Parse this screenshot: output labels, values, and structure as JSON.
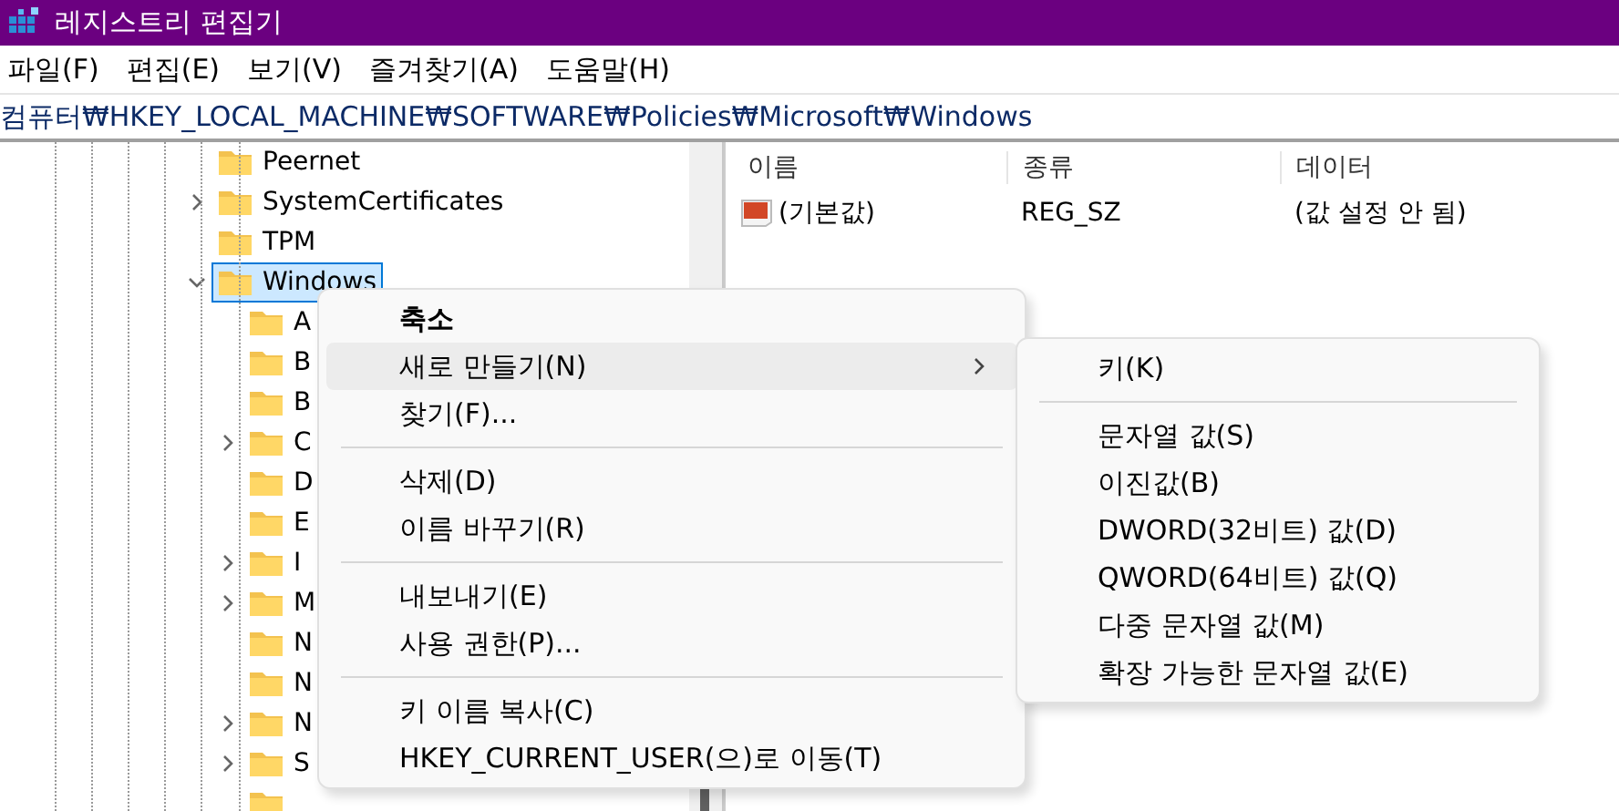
{
  "window": {
    "title": "레지스트리 편집기"
  },
  "menu_bar": [
    "파일(F)",
    "편집(E)",
    "보기(V)",
    "즐겨찾기(A)",
    "도움말(H)"
  ],
  "address_bar": {
    "value": "컴퓨터₩HKEY_LOCAL_MACHINE₩SOFTWARE₩Policies₩Microsoft₩Windows"
  },
  "tree": [
    {
      "label": "Peernet",
      "has_children": false,
      "expanded": false,
      "selected": false
    },
    {
      "label": "SystemCertificates",
      "has_children": true,
      "expanded": false,
      "selected": false
    },
    {
      "label": "TPM",
      "has_children": false,
      "expanded": false,
      "selected": false
    },
    {
      "label": "Windows",
      "has_children": true,
      "expanded": true,
      "selected": true,
      "children": [
        {
          "label": "A",
          "has_children": false,
          "expanded": false,
          "selected": false
        },
        {
          "label": "B",
          "has_children": false,
          "expanded": false,
          "selected": false
        },
        {
          "label": "B",
          "has_children": false,
          "expanded": false,
          "selected": false
        },
        {
          "label": "C",
          "has_children": true,
          "expanded": false,
          "selected": false
        },
        {
          "label": "D",
          "has_children": false,
          "expanded": false,
          "selected": false
        },
        {
          "label": "E",
          "has_children": false,
          "expanded": false,
          "selected": false
        },
        {
          "label": "I",
          "has_children": true,
          "expanded": false,
          "selected": false
        },
        {
          "label": "M",
          "has_children": true,
          "expanded": false,
          "selected": false
        },
        {
          "label": "N",
          "has_children": false,
          "expanded": false,
          "selected": false
        },
        {
          "label": "N",
          "has_children": false,
          "expanded": false,
          "selected": false
        },
        {
          "label": "N",
          "has_children": true,
          "expanded": false,
          "selected": false
        },
        {
          "label": "S",
          "has_children": true,
          "expanded": false,
          "selected": false
        },
        {
          "has_children": false,
          "expanded": false,
          "selected": false
        }
      ]
    }
  ],
  "values_table": {
    "columns": [
      "이름",
      "종류",
      "데이터"
    ],
    "rows": [
      {
        "name": "(기본값)",
        "type": "REG_SZ",
        "data": "(값 설정 안 됨)"
      }
    ]
  },
  "context_menu": {
    "groups": [
      [
        {
          "label": "축소",
          "bold": true,
          "selected": false,
          "submenu": false
        },
        {
          "label": "새로 만들기(N)",
          "bold": false,
          "selected": true,
          "submenu": true
        },
        {
          "label": "찾기(F)...",
          "bold": false,
          "selected": false,
          "submenu": false
        }
      ],
      [
        {
          "label": "삭제(D)",
          "bold": false,
          "selected": false,
          "submenu": false
        },
        {
          "label": "이름 바꾸기(R)",
          "bold": false,
          "selected": false,
          "submenu": false
        }
      ],
      [
        {
          "label": "내보내기(E)",
          "bold": false,
          "selected": false,
          "submenu": false
        },
        {
          "label": "사용 권한(P)...",
          "bold": false,
          "selected": false,
          "submenu": false
        }
      ],
      [
        {
          "label": "키 이름 복사(C)",
          "bold": false,
          "selected": false,
          "submenu": false
        },
        {
          "label": "HKEY_CURRENT_USER(으)로 이동(T)",
          "bold": false,
          "selected": false,
          "submenu": false
        }
      ]
    ]
  },
  "submenu": {
    "groups": [
      [
        "키(K)"
      ],
      [
        "문자열 값(S)",
        "이진값(B)",
        "DWORD(32비트) 값(D)",
        "QWORD(64비트) 값(Q)",
        "다중 문자열 값(M)",
        "확장 가능한 문자열 값(E)"
      ]
    ]
  }
}
